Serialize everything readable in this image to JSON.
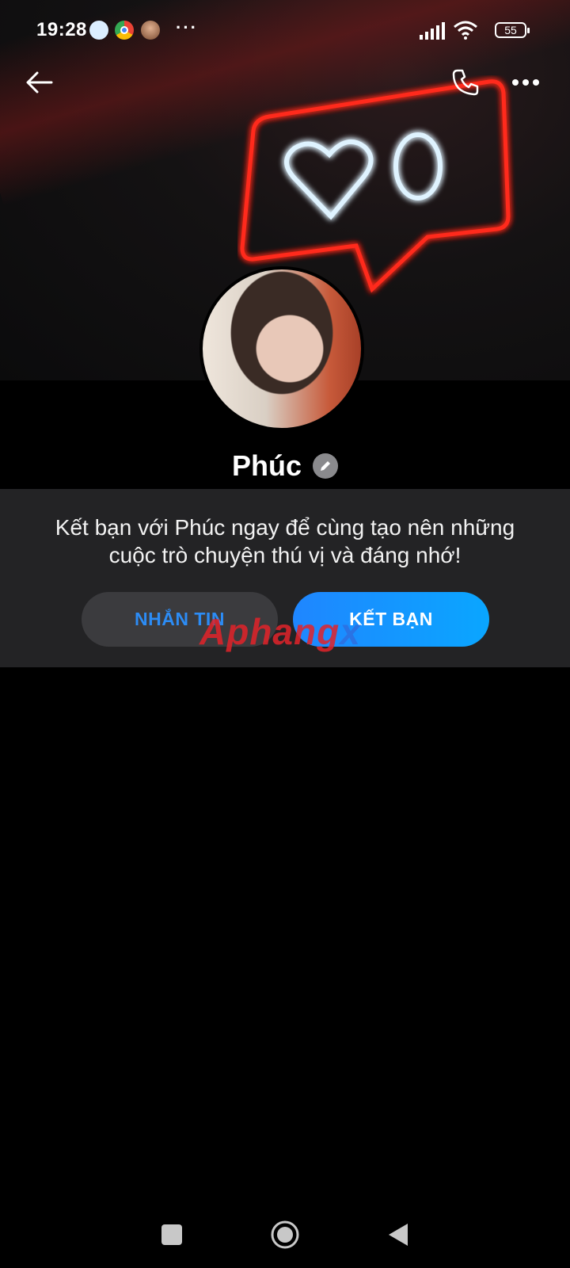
{
  "status_bar": {
    "time": "19:28",
    "more": "···",
    "battery": "55"
  },
  "profile": {
    "name": "Phúc"
  },
  "friend_prompt": {
    "message": "Kết bạn với Phúc ngay để cùng tạo nên những cuộc trò chuyện thú vị và đáng nhớ!",
    "message_button": "NHẮN TIN",
    "add_friend_button": "KẾT BẠN"
  },
  "watermark": {
    "part1": "Aphang",
    "part2": "x"
  },
  "colors": {
    "accent_blue": "#1f86ff",
    "card_bg": "#232325",
    "neon_red": "#ff2a1e",
    "neon_white": "#dff3ff"
  },
  "icons": [
    "back-arrow-icon",
    "phone-icon",
    "more-options-icon",
    "edit-pencil-icon",
    "home-square-icon",
    "home-circle-icon",
    "back-triangle-icon"
  ]
}
